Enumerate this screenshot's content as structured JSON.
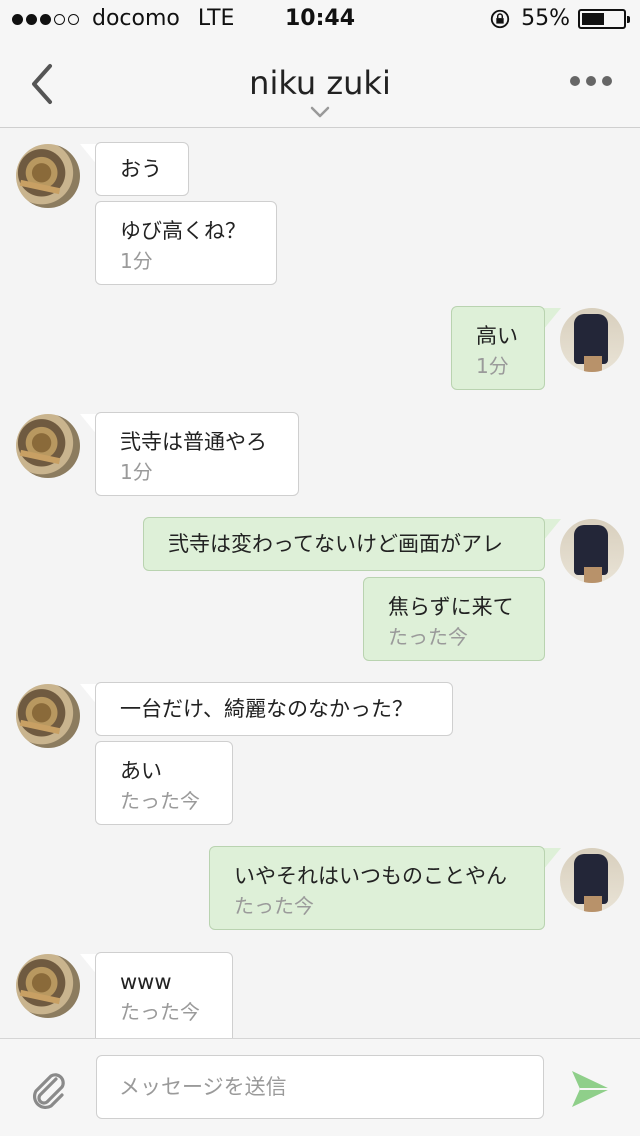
{
  "status": {
    "signal_bars": 3,
    "signal_total": 5,
    "carrier": "docomo",
    "network": "LTE",
    "time": "10:44",
    "battery": "55%",
    "battery_level": 0.55
  },
  "header": {
    "title": "niku zuki"
  },
  "messages": [
    {
      "side": "in",
      "text": "おう",
      "ts": ""
    },
    {
      "side": "in",
      "text": "ゆび高くね？",
      "ts": "1分"
    },
    {
      "side": "out",
      "text": "高い",
      "ts": "1分"
    },
    {
      "side": "in",
      "text": "弐寺は普通やろ",
      "ts": "1分"
    },
    {
      "side": "out",
      "text": "弐寺は変わってないけど画面がアレ",
      "ts": ""
    },
    {
      "side": "out",
      "text": "焦らずに来て",
      "ts": "たった今"
    },
    {
      "side": "in",
      "text": "一台だけ、綺麗なのなかった？",
      "ts": ""
    },
    {
      "side": "in",
      "text": "あい",
      "ts": "たった今"
    },
    {
      "side": "out",
      "text": "いやそれはいつものことやん",
      "ts": "たった今"
    },
    {
      "side": "in",
      "text": "www",
      "ts": "たった今"
    }
  ],
  "composer": {
    "placeholder": "メッセージを送信",
    "value": ""
  },
  "colors": {
    "incoming_bubble": "#ffffff",
    "outgoing_bubble": "#def0d8",
    "send_icon": "#8fcf8a",
    "attach_icon": "#8a8a8a"
  },
  "icons": {
    "back": "chevron-left-icon",
    "title_dropdown": "chevron-down-icon",
    "more": "more-dots-icon",
    "attach": "paperclip-icon",
    "send": "send-icon",
    "rotation_lock": "rotation-lock-icon"
  }
}
